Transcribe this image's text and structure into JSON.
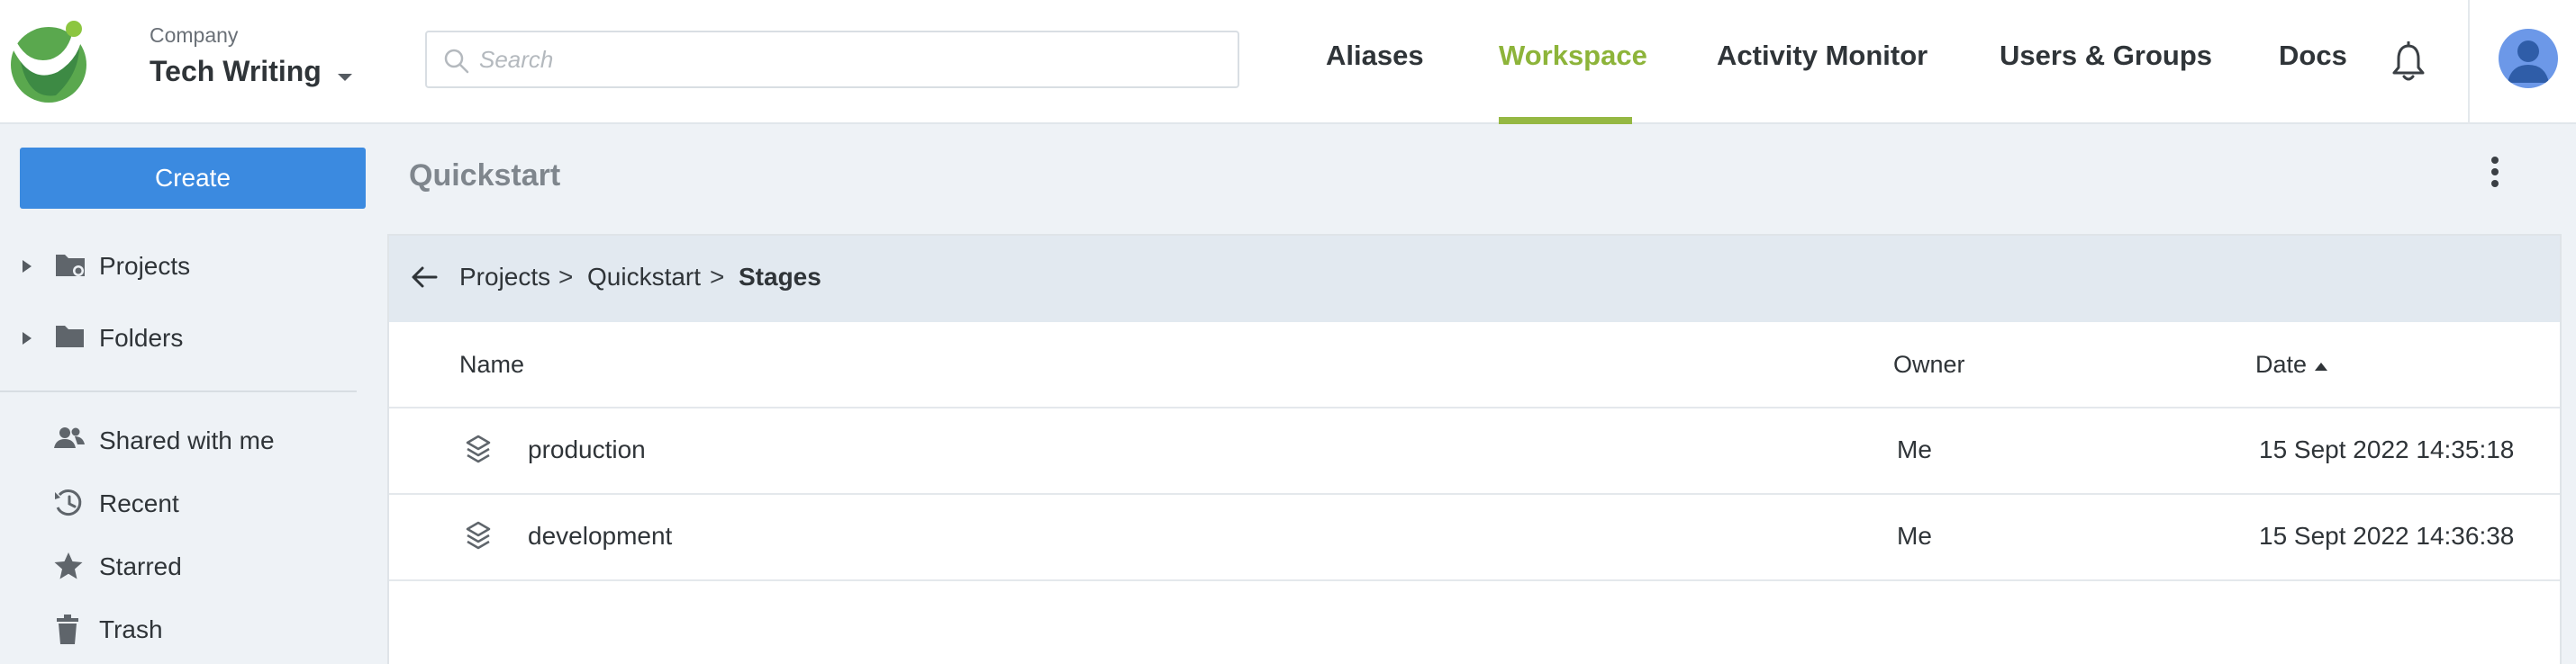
{
  "header": {
    "company_caption": "Company",
    "company_name": "Tech Writing",
    "search_placeholder": "Search",
    "nav": [
      {
        "label": "Aliases",
        "active": false
      },
      {
        "label": "Workspace",
        "active": true
      },
      {
        "label": "Activity Monitor",
        "active": false
      },
      {
        "label": "Users & Groups",
        "active": false
      },
      {
        "label": "Docs",
        "active": false
      }
    ],
    "icons": {
      "logo": "company-logo",
      "caret": "caret-down-icon",
      "search": "search-icon",
      "bell": "bell-icon",
      "avatar": "user-avatar-icon"
    }
  },
  "sidebar": {
    "create_label": "Create",
    "tree": [
      {
        "label": "Projects",
        "icon": "project-folder-icon"
      },
      {
        "label": "Folders",
        "icon": "folder-icon"
      }
    ],
    "items": [
      {
        "label": "Shared with me",
        "icon": "shared-users-icon"
      },
      {
        "label": "Recent",
        "icon": "history-icon"
      },
      {
        "label": "Starred",
        "icon": "star-icon"
      },
      {
        "label": "Trash",
        "icon": "trash-icon"
      }
    ]
  },
  "main": {
    "title": "Quickstart",
    "breadcrumb": {
      "items": [
        "Projects",
        "Quickstart"
      ],
      "separator": ">",
      "current": "Stages"
    },
    "table": {
      "columns": [
        "Name",
        "Owner",
        "Date"
      ],
      "sort_column": "Date",
      "rows": [
        {
          "name": "production",
          "owner": "Me",
          "date": "15 Sept 2022 14:35:18",
          "icon": "stage-layers-icon"
        },
        {
          "name": "development",
          "owner": "Me",
          "date": "15 Sept 2022 14:36:38",
          "icon": "stage-layers-icon"
        }
      ]
    }
  },
  "colors": {
    "accent_green": "#8db43a",
    "create_blue": "#3b8ae0",
    "avatar_blue": "#6c98e8"
  }
}
